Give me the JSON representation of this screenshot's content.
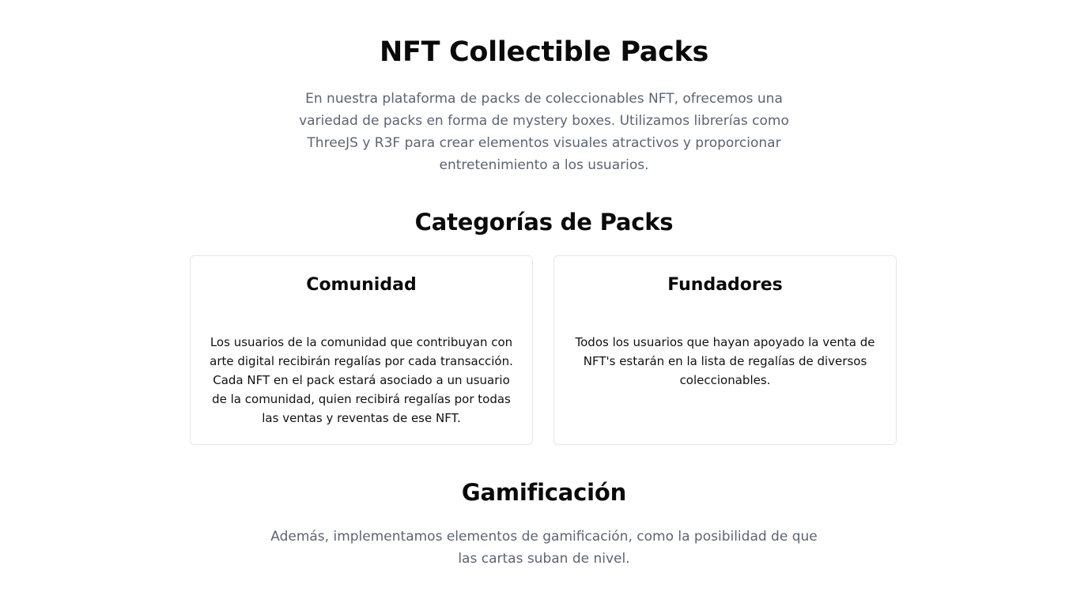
{
  "hero": {
    "title": "NFT Collectible Packs",
    "description": "En nuestra plataforma de packs de coleccionables NFT, ofrecemos una variedad de packs en forma de mystery boxes. Utilizamos librerías como ThreeJS y R3F para crear elementos visuales atractivos y proporcionar entretenimiento a los usuarios."
  },
  "categories": {
    "title": "Categorías de Packs",
    "cards": [
      {
        "title": "Comunidad",
        "text": "Los usuarios de la comunidad que contribuyan con arte digital recibirán regalías por cada transacción. Cada NFT en el pack estará asociado a un usuario de la comunidad, quien recibirá regalías por todas las ventas y reventas de ese NFT."
      },
      {
        "title": "Fundadores",
        "text": "Todos los usuarios que hayan apoyado la venta de NFT's estarán en la lista de regalías de diversos coleccionables."
      }
    ]
  },
  "gamification": {
    "title": "Gamificación",
    "description": "Además, implementamos elementos de gamificación, como la posibilidad de que las cartas suban de nivel."
  }
}
